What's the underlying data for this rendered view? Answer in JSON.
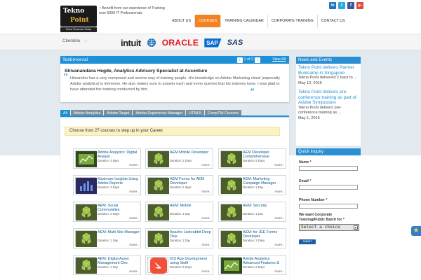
{
  "header": {
    "logo_text_1": "Tekno",
    "logo_text_2": "Point",
    "logo_tag": "Know Tomorrow Today",
    "tagline": ":: Benefit from our experience of Training over 5000 IT Professionals",
    "social": [
      "in",
      "t",
      "f",
      "g+"
    ],
    "social_colors": [
      "#1b75bb",
      "#27aae1",
      "#3b5998",
      "#dd4b39"
    ],
    "nav": [
      "ABOUT US",
      "COURSES",
      "TRAINING CALENDAR",
      "CORPORATE TRAINING",
      "CONTACT US"
    ],
    "nav_active_index": 1,
    "accent_color": "#f58220"
  },
  "clientele": {
    "label": "Clientele",
    "arrow": "→",
    "logos": [
      "intuit",
      "ORACLE",
      "SAP",
      "SAS"
    ]
  },
  "testimonial": {
    "title": "Testimonial",
    "pager": "1 of 2",
    "prev": "‹",
    "next": "›",
    "view_all": "View All",
    "name": "Shivanandana Hegde, Analytics Advisory Specialist at Accenture",
    "body": "Himanshu has a very composed and serene way of training people. His knowledge on Adobe Marketing cloud (especially Adobe analytics) is immense. He also makes sure to answer each and every queries that his trainees have. I was glad to have attended the training conducted by him."
  },
  "tabs": [
    "All",
    "Adobe Analytics",
    "Adobe Target",
    "Adobe Experience Manager",
    "HTML5",
    "CompTIA Courses"
  ],
  "choose_text": "Choose from 27 courses to step up in your Career.",
  "courses": [
    {
      "title": "Adobe Analytics: Digital Analyst",
      "duration": "Duration: 4 days",
      "more": "more..",
      "icon": "chart-icon"
    },
    {
      "title": "AEM Mobile Developer",
      "duration": "Duration: 2 Days",
      "more": "more..",
      "icon": "cubes-icon"
    },
    {
      "title": "AEM Developer Comprehensive",
      "duration": "Duration: 5 Days",
      "more": "more..",
      "icon": "cubes-icon"
    },
    {
      "title": "Maximize Insights Using Adobe Reports",
      "duration": "Duration: 3 Days",
      "more": "more..",
      "icon": "report-icon"
    },
    {
      "title": "AEM Forms for AEM Developer",
      "duration": "Duration: 2 days",
      "more": "more..",
      "icon": "cubes-icon"
    },
    {
      "title": "AEM: Marketing Campaign Manager",
      "duration": "Duration: 1 Day",
      "more": "more..",
      "icon": "cubes-icon"
    },
    {
      "title": "AEM: Social Communities",
      "duration": "Duration: 2 Days",
      "more": "more..",
      "icon": "cubes-icon"
    },
    {
      "title": "AEM: Mobile",
      "duration": "Duration: 1 Day",
      "more": "more..",
      "icon": "cubes-icon"
    },
    {
      "title": "AEM: Security",
      "duration": "Duration: 1 Day",
      "more": "more..",
      "icon": "cubes-icon"
    },
    {
      "title": "AEM: Multi Site Manager",
      "duration": "Duration: 1 Day",
      "more": "more..",
      "icon": "cubes-icon"
    },
    {
      "title": "Apache Jackrabbit Deep Dive",
      "duration": "Duration: 1 Day",
      "more": "more..",
      "icon": "cubes-icon"
    },
    {
      "title": "AEM: for JEE Forms Developer",
      "duration": "Duration: 2 Days",
      "more": "more..",
      "icon": "cubes-icon"
    },
    {
      "title": "AEM: Digital Asset Management Dev.",
      "duration": "Duration: 1 Day",
      "more": "more..",
      "icon": "cubes-icon"
    },
    {
      "title": "iOS App Development using Swift",
      "duration": "Duration: 5 Days",
      "more": "more..",
      "icon": "swift-icon"
    },
    {
      "title": "Adobe Analytics Advanced Features &",
      "duration": "Duration: 2 Days",
      "more": "more..",
      "icon": "chart-icon"
    }
  ],
  "news": {
    "title": "News and Events",
    "items": [
      {
        "title": "Tekno Point delivers Partner Bootcamp in Singapore",
        "text": "Tekno Point delivered 2 back to ...",
        "date": "May 12, 2016"
      },
      {
        "title": "Tekno Point delivers pre-conference training as part of Adobe Symposium",
        "text": "Tekno Point delivers pre-conference training as ...",
        "date": "May 1, 2016"
      }
    ]
  },
  "inquiry": {
    "title": "Quick Inquiry",
    "name_label": "Name",
    "email_label": "Email",
    "phone_label": "Phone Number",
    "batch_label": "We want Corporate Training/Public Batch for",
    "required_mark": "*",
    "select_value": "Select a choice",
    "submit_label": "SUBMIT"
  },
  "badge": "★"
}
